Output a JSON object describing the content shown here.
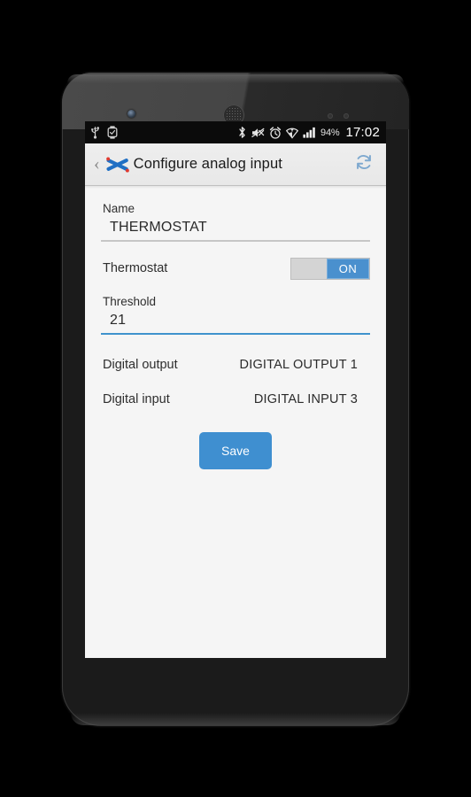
{
  "device": {
    "sensor_icon": "proximity-sensor",
    "earpiece_icon": "earpiece-speaker",
    "camera_icon": "front-camera"
  },
  "statusbar": {
    "left_icons": [
      {
        "name": "usb-icon",
        "label": "USB"
      },
      {
        "name": "smartwatch-icon",
        "label": "Watch"
      }
    ],
    "right_icons": [
      {
        "name": "bluetooth-icon",
        "label": "Bluetooth"
      },
      {
        "name": "mute-icon",
        "label": "Silent"
      },
      {
        "name": "alarm-icon",
        "label": "Alarm"
      },
      {
        "name": "wifi-icon",
        "label": "Wi-Fi"
      },
      {
        "name": "cellular-signal-icon",
        "label": "Signal"
      }
    ],
    "battery": "94%",
    "clock": "17:02"
  },
  "actionbar": {
    "back_glyph": "‹",
    "app_logo": "digi-x-logo",
    "title": "Configure analog input",
    "refresh_icon": "refresh-icon",
    "accent_color": "#7fa9cf"
  },
  "form": {
    "name": {
      "label": "Name",
      "value": "THERMOSTAT",
      "placeholder": "Name",
      "focused": false
    },
    "thermostat_toggle": {
      "label": "Thermostat",
      "state_label": "ON",
      "checked": true,
      "on_color": "#4a90ce",
      "track_color": "#d4d4d4"
    },
    "threshold": {
      "label": "Threshold",
      "value": "21",
      "placeholder": "Threshold",
      "focused": true,
      "focus_color": "#3f92cd"
    },
    "rows": [
      {
        "key": "Digital output",
        "value": "DIGITAL OUTPUT 1"
      },
      {
        "key": "Digital input",
        "value": "DIGITAL INPUT 3"
      }
    ],
    "save_label": "Save",
    "save_color": "#3f8fd0"
  }
}
